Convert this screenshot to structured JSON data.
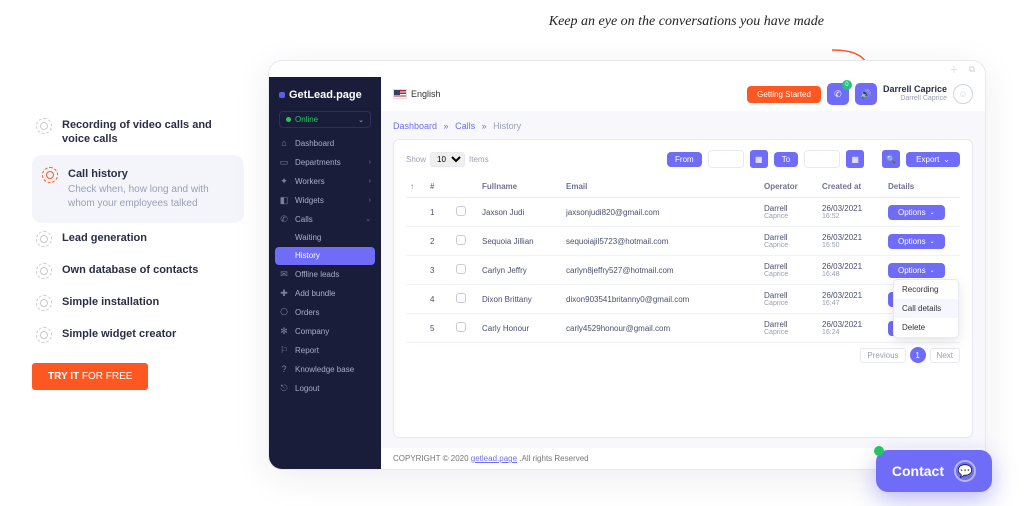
{
  "callout": "Keep an eye on the conversations you have made",
  "features": [
    {
      "label": "Recording of video calls and voice calls"
    },
    {
      "label": "Call history",
      "desc": "Check when, how long and with whom your employees talked",
      "active": true
    },
    {
      "label": "Lead generation"
    },
    {
      "label": "Own database of contacts"
    },
    {
      "label": "Simple installation"
    },
    {
      "label": "Simple widget creator"
    }
  ],
  "cta": {
    "bold": "TRY IT",
    "rest": " FOR FREE"
  },
  "brand": "GetLead.page",
  "status": "Online",
  "sidebar": {
    "items": [
      {
        "label": "Dashboard",
        "icon": "⌂"
      },
      {
        "label": "Departments",
        "icon": "▭",
        "expand": true
      },
      {
        "label": "Workers",
        "icon": "✦",
        "expand": true
      },
      {
        "label": "Widgets",
        "icon": "◧",
        "expand": true
      },
      {
        "label": "Calls",
        "icon": "✆",
        "expanded": true,
        "subs": [
          {
            "label": "Waiting"
          },
          {
            "label": "History",
            "active": true
          }
        ]
      },
      {
        "label": "Offline leads",
        "icon": "✉"
      },
      {
        "label": "Add bundle",
        "icon": "✚"
      },
      {
        "label": "Orders",
        "icon": "⎔"
      },
      {
        "label": "Company",
        "icon": "✻"
      },
      {
        "label": "Report",
        "icon": "⚐"
      },
      {
        "label": "Knowledge base",
        "icon": "?"
      },
      {
        "label": "Logout",
        "icon": "⎋"
      }
    ]
  },
  "topbar": {
    "lang": "English",
    "getting_started": "Getting Started",
    "call_badge": "0",
    "user_name": "Darrell Caprice",
    "user_sub": "Darrell Caprice"
  },
  "crumbs": {
    "a": "Dashboard",
    "b": "Calls",
    "c": "History"
  },
  "table": {
    "show_label": "Show",
    "show_value": "10",
    "items_label": "Items",
    "from": "From",
    "to": "To",
    "export": "Export",
    "headers": {
      "num": "#",
      "fullname": "Fullname",
      "email": "Email",
      "operator": "Operator",
      "created": "Created at",
      "details": "Details"
    },
    "option_label": "Options",
    "rows": [
      {
        "n": "1",
        "name": "Jaxson Judi",
        "email": "jaxsonjudi820@gmail.com",
        "op": "Darrell Caprice",
        "date": "26/03/2021",
        "time": "16:52"
      },
      {
        "n": "2",
        "name": "Sequoia Jillian",
        "email": "sequoiajil5723@hotmail.com",
        "op": "Darrell Caprice",
        "date": "26/03/2021",
        "time": "16:50"
      },
      {
        "n": "3",
        "name": "Carlyn Jeffry",
        "email": "carlyn8jeffry527@hotmail.com",
        "op": "Darrell Caprice",
        "date": "26/03/2021",
        "time": "16:48"
      },
      {
        "n": "4",
        "name": "Dixon Brittany",
        "email": "dixon903541britanny0@gmail.com",
        "op": "Darrell Caprice",
        "date": "26/03/2021",
        "time": "16:47"
      },
      {
        "n": "5",
        "name": "Carly Honour",
        "email": "carly4529honour@gmail.com",
        "op": "Darrell Caprice",
        "date": "26/03/2021",
        "time": "16:24"
      }
    ]
  },
  "dropdown": {
    "a": "Recording",
    "b": "Call details",
    "c": "Delete"
  },
  "pager": {
    "prev": "Previous",
    "cur": "1",
    "next": "Next"
  },
  "footer": {
    "pre": "COPYRIGHT © 2020 ",
    "link": "getlead.page",
    "post": " .All rights Reserved"
  },
  "contact": "Contact"
}
